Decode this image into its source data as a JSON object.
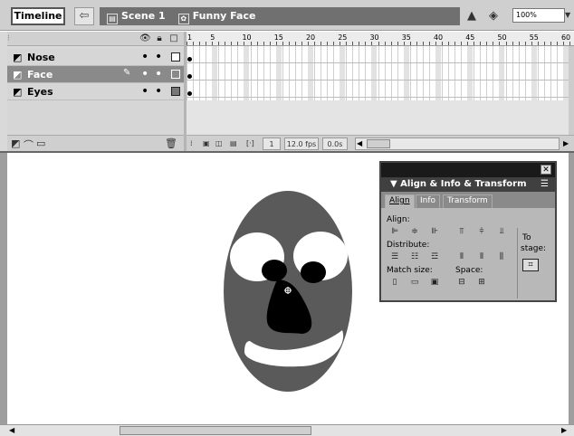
{
  "topbar": {
    "timeline_button": "Timeline",
    "back_icon": "arrow-left-icon",
    "breadcrumb": [
      {
        "icon": "scene-icon",
        "label": "Scene 1"
      },
      {
        "icon": "symbol-icon",
        "label": "Funny Face"
      }
    ],
    "zoom": "100%"
  },
  "timeline": {
    "header_icons": [
      "eye-icon",
      "lock-icon",
      "outline-icon"
    ],
    "layers": [
      {
        "name": "Nose",
        "selected": false,
        "outline_filled": false
      },
      {
        "name": "Face",
        "selected": true,
        "outline_filled": false
      },
      {
        "name": "Eyes",
        "selected": false,
        "outline_filled": true
      }
    ],
    "ruler_numbers": [
      "1",
      "5",
      "10",
      "15",
      "20",
      "25",
      "30",
      "35",
      "40",
      "45",
      "50",
      "55",
      "60"
    ],
    "current_frame": "1",
    "frame_rate": "12.0 fps",
    "elapsed": "0.0s"
  },
  "panel": {
    "title": "Align & Info & Transform",
    "tabs": [
      "Align",
      "Info",
      "Transform"
    ],
    "labels": {
      "align": "Align:",
      "distribute": "Distribute:",
      "match_size": "Match size:",
      "space": "Space:",
      "to_stage_1": "To",
      "to_stage_2": "stage:"
    }
  },
  "colors": {
    "face": "#5a5a5a",
    "eye": "#ffffff",
    "nostril": "#000000",
    "accent_bar": "#404040"
  }
}
